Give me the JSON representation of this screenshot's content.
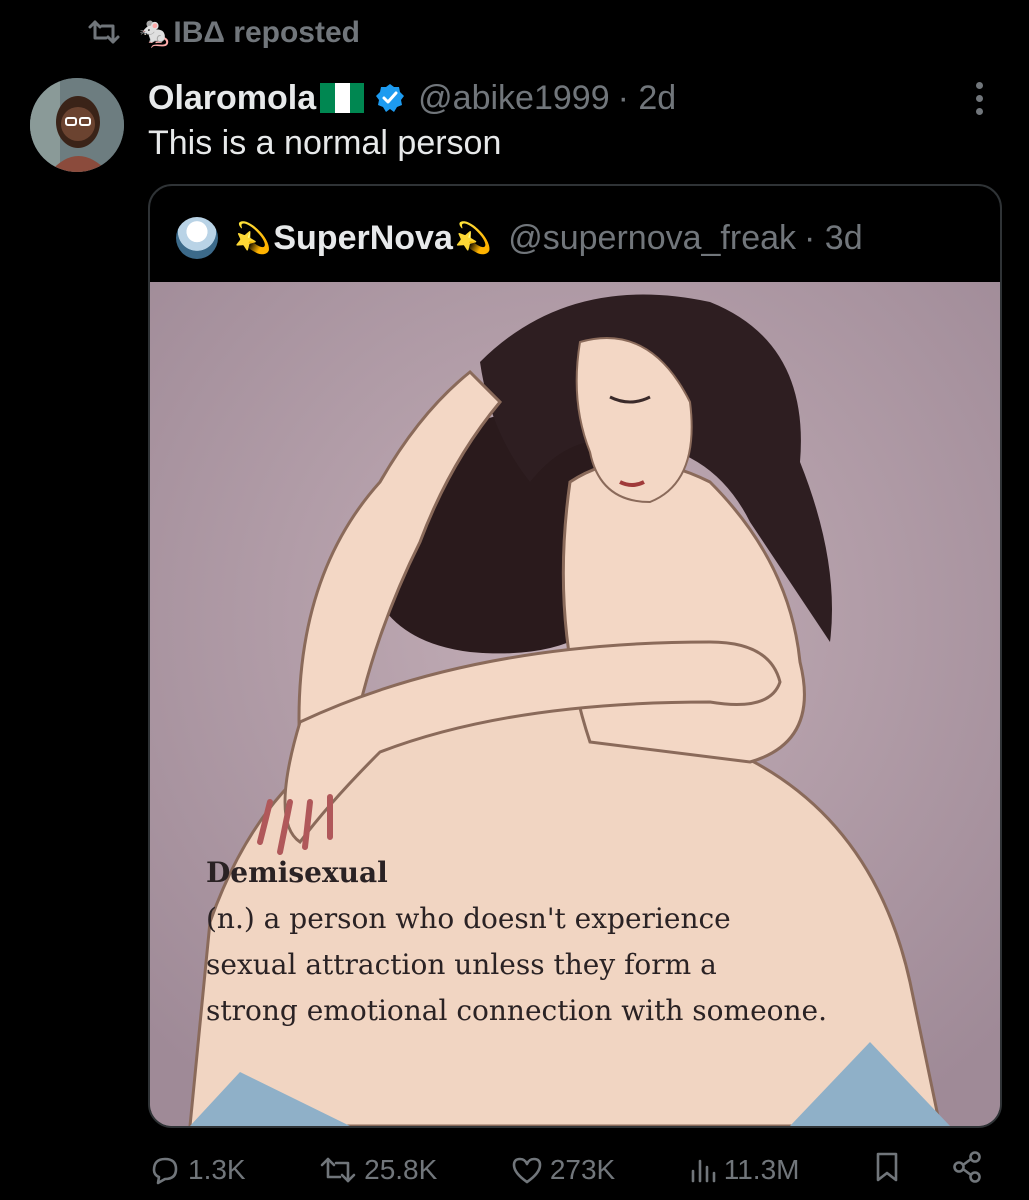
{
  "repost": {
    "icon": "repost-icon",
    "reposter_emoji": "🐁",
    "reposter_name": "IBΔ",
    "label": "reposted"
  },
  "post": {
    "author_name": "Olaromola",
    "author_flag": "nigeria-flag",
    "verified_icon": "verified-badge-icon",
    "handle": "@abike1999",
    "time": "· 2d",
    "text": "This is a normal person"
  },
  "quote": {
    "sparkle_left": "💫",
    "author_name": "SuperNova",
    "sparkle_right": "💫",
    "handle": "@supernova_freak",
    "time": "· 3d",
    "image": {
      "description_kind": "illustration",
      "caption_term": "Demisexual",
      "caption_lines": [
        "(n.) a person who doesn't experience",
        "sexual attraction unless they form a",
        "strong emotional connection with someone."
      ]
    }
  },
  "stats": {
    "replies": "1.3K",
    "reposts": "25.8K",
    "likes": "273K",
    "views": "11.3M"
  },
  "colors": {
    "background": "#000000",
    "text": "#e7e9ea",
    "muted": "#71767b",
    "verified": "#1d9bf0",
    "border": "#2f3336"
  }
}
